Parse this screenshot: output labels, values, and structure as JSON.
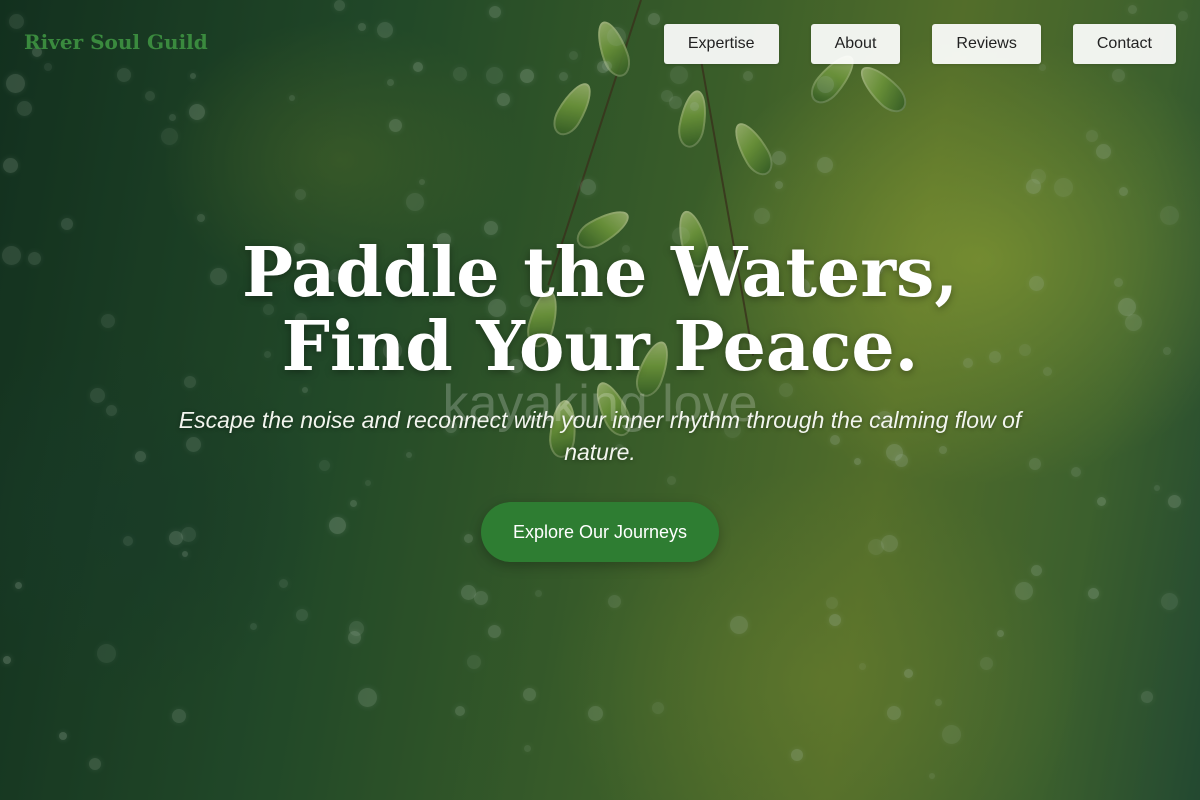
{
  "brand": {
    "name": "River Soul Guild",
    "color": "#3a8a3e"
  },
  "nav": {
    "items": [
      {
        "label": "Expertise"
      },
      {
        "label": "About"
      },
      {
        "label": "Reviews"
      },
      {
        "label": "Contact"
      }
    ]
  },
  "hero": {
    "headline": "Paddle the Waters, Find Your Peace.",
    "watermark": "kayaking love",
    "subtitle": "Escape the noise and reconnect with your inner rhythm through the calming flow of nature.",
    "cta_label": "Explore Our Journeys",
    "cta_color": "#2e7d32",
    "background_image": "blurred-green-foliage-with-rain-bokeh"
  }
}
